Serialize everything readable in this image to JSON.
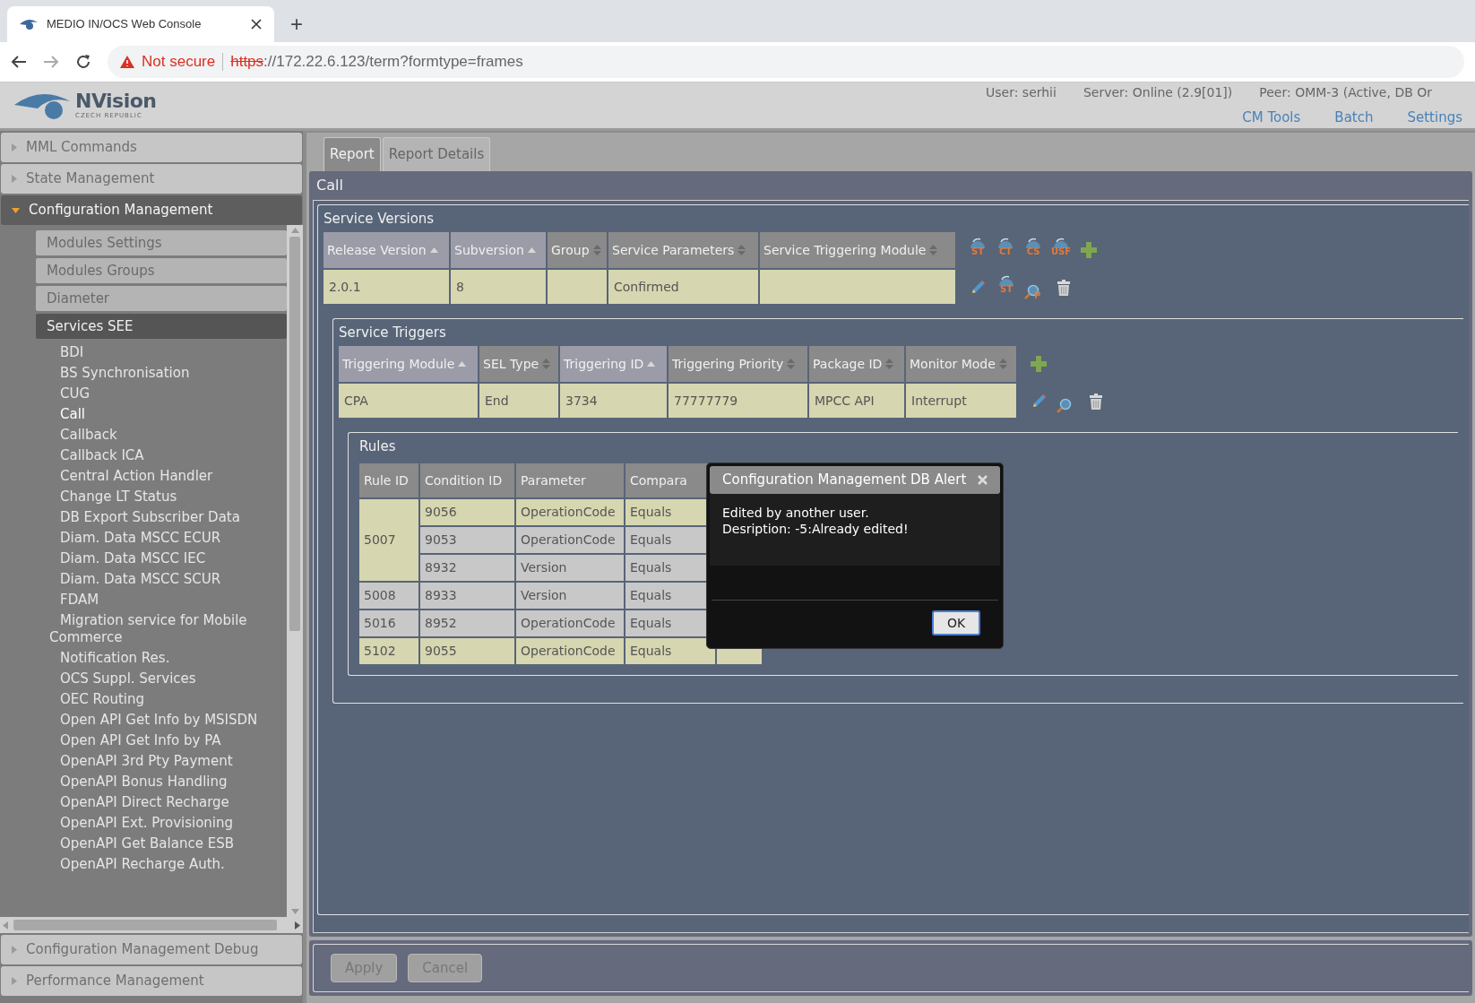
{
  "browser": {
    "tab_title": "MEDIO IN/OCS Web Console",
    "new_tab": "+",
    "security": "Not secure",
    "url_scheme": "https",
    "url_rest": "://172.22.6.123/term?formtype=frames"
  },
  "header": {
    "logo_name": "NVision",
    "logo_sub": "CZECH REPUBLIC",
    "status": [
      "User: serhii",
      "Server: Online (2.9[01])",
      "Peer: OMM-3 (Active, DB Or"
    ],
    "links": [
      "CM Tools",
      "Batch",
      "Settings"
    ]
  },
  "sidebar": {
    "sections": [
      {
        "label": "MML Commands",
        "expanded": false
      },
      {
        "label": "State Management",
        "expanded": false
      },
      {
        "label": "Configuration Management",
        "expanded": true,
        "items": [
          {
            "label": "Modules Settings",
            "selected": false
          },
          {
            "label": "Modules Groups",
            "selected": false
          },
          {
            "label": "Diameter",
            "selected": false
          },
          {
            "label": "Services SEE",
            "selected": true,
            "children": [
              {
                "label": "BDI",
                "selected": false
              },
              {
                "label": "BS Synchronisation",
                "selected": false
              },
              {
                "label": "CUG",
                "selected": false
              },
              {
                "label": "Call",
                "selected": true
              },
              {
                "label": "Callback",
                "selected": false
              },
              {
                "label": "Callback ICA",
                "selected": false
              },
              {
                "label": "Central Action Handler",
                "selected": false
              },
              {
                "label": "Change LT Status",
                "selected": false
              },
              {
                "label": "DB Export Subscriber Data",
                "selected": false
              },
              {
                "label": "Diam. Data MSCC ECUR",
                "selected": false
              },
              {
                "label": "Diam. Data MSCC IEC",
                "selected": false
              },
              {
                "label": "Diam. Data MSCC SCUR",
                "selected": false
              },
              {
                "label": "FDAM",
                "selected": false
              },
              {
                "label": "Migration service for Mobile Commerce",
                "selected": false
              },
              {
                "label": "Notification Res.",
                "selected": false
              },
              {
                "label": "OCS Suppl. Services",
                "selected": false
              },
              {
                "label": "OEC Routing",
                "selected": false
              },
              {
                "label": "Open API Get Info by MSISDN",
                "selected": false
              },
              {
                "label": "Open API Get Info by PA",
                "selected": false
              },
              {
                "label": "OpenAPI 3rd Pty Payment",
                "selected": false
              },
              {
                "label": "OpenAPI Bonus Handling",
                "selected": false
              },
              {
                "label": "OpenAPI Direct Recharge",
                "selected": false
              },
              {
                "label": "OpenAPI Ext. Provisioning",
                "selected": false
              },
              {
                "label": "OpenAPI Get Balance ESB",
                "selected": false
              },
              {
                "label": "OpenAPI Recharge Auth.",
                "selected": false
              }
            ]
          }
        ]
      },
      {
        "label": "Configuration Management Debug",
        "expanded": false
      },
      {
        "label": "Performance Management",
        "expanded": false
      }
    ]
  },
  "tabs": [
    {
      "label": "Report",
      "selected": true
    },
    {
      "label": "Report Details",
      "selected": false
    }
  ],
  "panel_title": "Call",
  "service_versions": {
    "title": "Service Versions",
    "columns": [
      {
        "label": "Release Version",
        "sorted": true
      },
      {
        "label": "Subversion",
        "sorted": true
      },
      {
        "label": "Group",
        "sorted": false
      },
      {
        "label": "Service Parameters",
        "sorted": false
      },
      {
        "label": "Service Triggering Module",
        "sorted": false
      }
    ],
    "rows": [
      [
        "2.0.1",
        "8",
        null,
        "Confirmed",
        null
      ]
    ],
    "toolbar": [
      {
        "kind": "globe",
        "label": "ST"
      },
      {
        "kind": "globe",
        "label": "CT"
      },
      {
        "kind": "globe",
        "label": "CS"
      },
      {
        "kind": "globe",
        "label": "USF"
      },
      {
        "kind": "add"
      }
    ],
    "row_actions": [
      {
        "kind": "edit"
      },
      {
        "kind": "globe",
        "label": "ST"
      },
      {
        "kind": "search",
        "label": "P"
      },
      {
        "kind": "delete"
      }
    ]
  },
  "service_triggers": {
    "title": "Service Triggers",
    "columns": [
      {
        "label": "Triggering Module",
        "sorted": true
      },
      {
        "label": "SEL Type",
        "sorted": false
      },
      {
        "label": "Triggering ID",
        "sorted": true
      },
      {
        "label": "Triggering Priority",
        "sorted": false
      },
      {
        "label": "Package ID",
        "sorted": false
      },
      {
        "label": "Monitor Mode",
        "sorted": false
      }
    ],
    "rows": [
      [
        "CPA",
        "End",
        "3734",
        "77777779",
        "MPCC API",
        "Interrupt"
      ]
    ],
    "toolbar": [
      {
        "kind": "add"
      }
    ],
    "row_actions": [
      {
        "kind": "edit"
      },
      {
        "kind": "search"
      },
      {
        "kind": "delete"
      }
    ]
  },
  "rules": {
    "title": "Rules",
    "columns": [
      "Rule ID",
      "Condition ID",
      "Parameter",
      "Compara"
    ],
    "groups": [
      {
        "rule_id": "5007",
        "highlighted": true,
        "conditions": [
          {
            "condition_id": "9056",
            "parameter": "OperationCode",
            "comparison": "Equals",
            "highlighted": true
          },
          {
            "condition_id": "9053",
            "parameter": "OperationCode",
            "comparison": "Equals",
            "highlighted": false
          },
          {
            "condition_id": "8932",
            "parameter": "Version",
            "comparison": "Equals",
            "highlighted": false
          }
        ]
      },
      {
        "rule_id": "5008",
        "highlighted": false,
        "conditions": [
          {
            "condition_id": "8933",
            "parameter": "Version",
            "comparison": "Equals",
            "highlighted": false
          }
        ]
      },
      {
        "rule_id": "5016",
        "highlighted": false,
        "conditions": [
          {
            "condition_id": "8952",
            "parameter": "OperationCode",
            "comparison": "Equals",
            "highlighted": false
          }
        ]
      },
      {
        "rule_id": "5102",
        "highlighted": true,
        "conditions": [
          {
            "condition_id": "9055",
            "parameter": "OperationCode",
            "comparison": "Equals",
            "highlighted": true
          }
        ]
      }
    ]
  },
  "dialog": {
    "title": "Configuration Management DB Alert",
    "lines": [
      "Edited by another user.",
      "Desription: -5:Already edited!"
    ],
    "button": "OK"
  },
  "footer_buttons": [
    {
      "label": "Apply",
      "disabled": true
    },
    {
      "label": "Cancel",
      "disabled": true
    }
  ]
}
